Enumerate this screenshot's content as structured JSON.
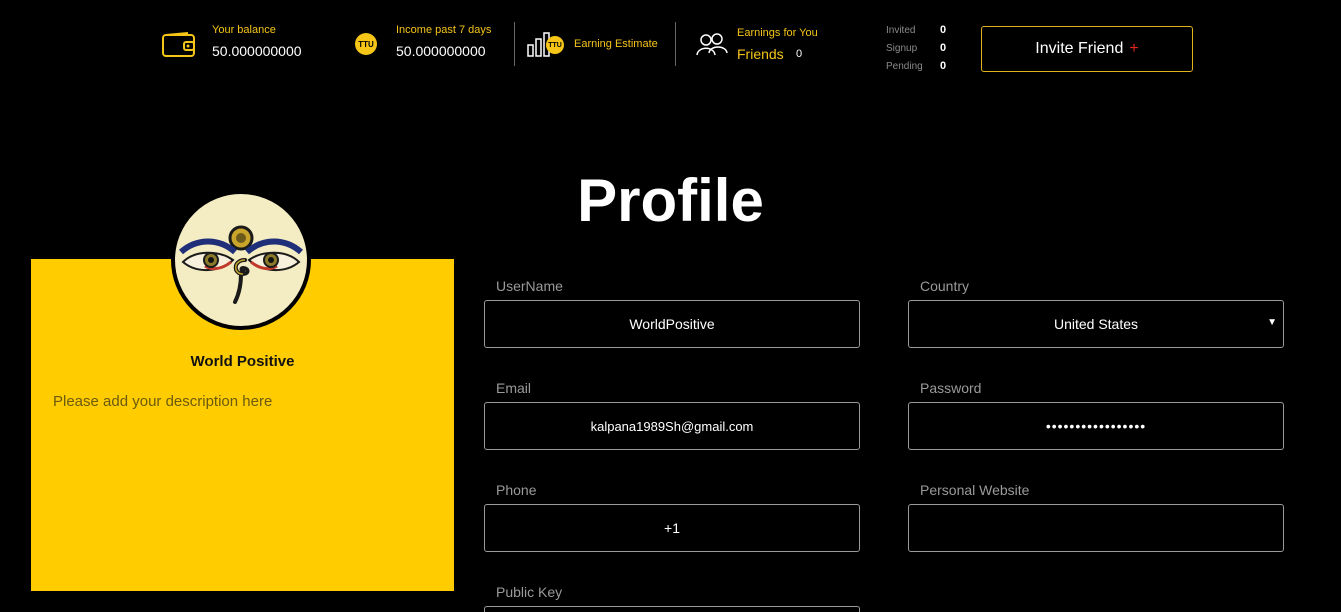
{
  "topbar": {
    "balance": {
      "label": "Your balance",
      "value": "50.000000000"
    },
    "income": {
      "label": "Income past 7 days",
      "value": "50.000000000",
      "coin": "TTU"
    },
    "estimate": {
      "label": "Earning Estimate",
      "coin": "TTU"
    },
    "earnings": {
      "label": "Earnings for You",
      "friends_label": "Friends",
      "friends_count": "0"
    },
    "stats": [
      {
        "label": "Invited",
        "value": "0"
      },
      {
        "label": "Signup",
        "value": "0"
      },
      {
        "label": "Pending",
        "value": "0"
      }
    ],
    "invite_button": {
      "label": "Invite Friend",
      "plus": "+"
    }
  },
  "page": {
    "title": "Profile"
  },
  "profile_card": {
    "name": "World Positive",
    "description_placeholder": "Please add your description here"
  },
  "form": {
    "username": {
      "label": "UserName",
      "value": "WorldPositive"
    },
    "country": {
      "label": "Country",
      "value": "United States"
    },
    "email": {
      "label": "Email",
      "value": "kalpana1989Sh@gmail.com"
    },
    "password": {
      "label": "Password",
      "value": "•••••••••••••••••"
    },
    "phone": {
      "label": "Phone",
      "value": "+1"
    },
    "website": {
      "label": "Personal Website",
      "value": ""
    },
    "public_key": {
      "label": "Public Key"
    }
  },
  "colors": {
    "accent": "#ffcc00",
    "background": "#000000",
    "plus": "#e0271c"
  }
}
